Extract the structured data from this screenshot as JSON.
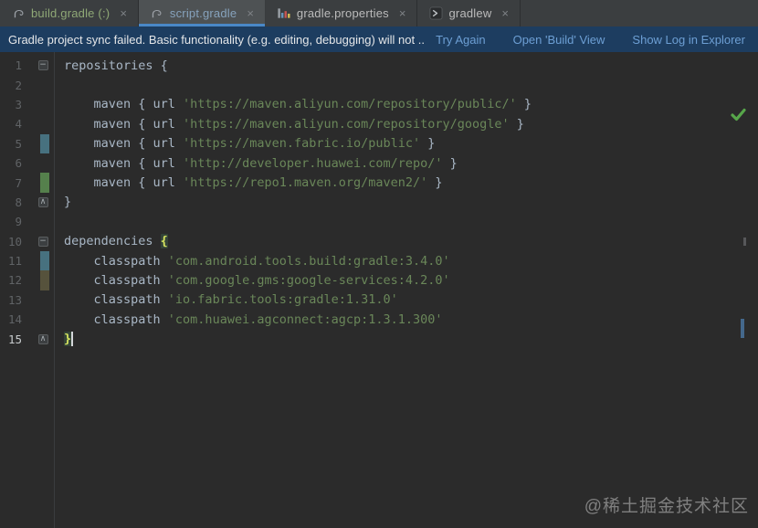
{
  "tabs": [
    {
      "label": "build.gradle (:)",
      "icon": "gradle-elephant",
      "label_color": "#8FA876",
      "active": false,
      "close": "×"
    },
    {
      "label": "script.gradle",
      "icon": "gradle-elephant",
      "label_color": "#86A2BC",
      "active": true,
      "close": "×"
    },
    {
      "label": "gradle.properties",
      "icon": "properties-file",
      "label_color": "#BBBBBB",
      "active": false,
      "close": "×"
    },
    {
      "label": "gradlew",
      "icon": "shell-script",
      "label_color": "#BBBBBB",
      "active": false,
      "close": "×"
    }
  ],
  "banner": {
    "message": "Gradle project sync failed. Basic functionality (e.g. editing, debugging) will not ...",
    "actions": [
      {
        "label": "Try Again"
      },
      {
        "label": "Open 'Build' View"
      },
      {
        "label": "Show Log in Explorer"
      }
    ]
  },
  "colors": {
    "active_tab_underline": "#4A88C7",
    "banner_bg": "#1D3D60",
    "link": "#6D9FD4",
    "code_plain": "#A9B7C6",
    "code_string": "#6A8759",
    "vcs_modified": "#47717F",
    "vcs_added": "#55804C",
    "vcs_modified_dim": "#56523C",
    "inspection_ok": "#57A64A"
  },
  "editor": {
    "lines": [
      {
        "num": "1",
        "fold": "open",
        "tokens": [
          {
            "t": "c",
            "s": "repositories {"
          }
        ]
      },
      {
        "num": "2",
        "tokens": []
      },
      {
        "num": "3",
        "tokens": [
          {
            "t": "c",
            "s": "    maven { url "
          },
          {
            "t": "s",
            "s": "'https://maven.aliyun.com/repository/public/'"
          },
          {
            "t": "c",
            "s": " }"
          }
        ]
      },
      {
        "num": "4",
        "tokens": [
          {
            "t": "c",
            "s": "    maven { url "
          },
          {
            "t": "s",
            "s": "'https://maven.aliyun.com/repository/google'"
          },
          {
            "t": "c",
            "s": " }"
          }
        ]
      },
      {
        "num": "5",
        "vcs": "modified",
        "tokens": [
          {
            "t": "c",
            "s": "    maven { url "
          },
          {
            "t": "s",
            "s": "'https://maven.fabric.io/public'"
          },
          {
            "t": "c",
            "s": " }"
          }
        ]
      },
      {
        "num": "6",
        "tokens": [
          {
            "t": "c",
            "s": "    maven { url "
          },
          {
            "t": "s",
            "s": "'http://developer.huawei.com/repo/'"
          },
          {
            "t": "c",
            "s": " }"
          }
        ]
      },
      {
        "num": "7",
        "vcs": "added",
        "tokens": [
          {
            "t": "c",
            "s": "    maven { url "
          },
          {
            "t": "s",
            "s": "'https://repo1.maven.org/maven2/'"
          },
          {
            "t": "c",
            "s": " }"
          }
        ]
      },
      {
        "num": "8",
        "fold": "close",
        "tokens": [
          {
            "t": "c",
            "s": "}"
          }
        ]
      },
      {
        "num": "9",
        "tokens": []
      },
      {
        "num": "10",
        "fold": "open",
        "tokens": [
          {
            "t": "c",
            "s": "dependencies "
          },
          {
            "t": "b",
            "s": "{"
          }
        ]
      },
      {
        "num": "11",
        "vcs": "modified",
        "tokens": [
          {
            "t": "c",
            "s": "    classpath "
          },
          {
            "t": "s",
            "s": "'com.android.tools.build:gradle:3.4.0'"
          }
        ]
      },
      {
        "num": "12",
        "vcs": "modified_dim",
        "tokens": [
          {
            "t": "c",
            "s": "    classpath "
          },
          {
            "t": "s",
            "s": "'com.google.gms:google-services:4.2.0'"
          }
        ]
      },
      {
        "num": "13",
        "tokens": [
          {
            "t": "c",
            "s": "    classpath "
          },
          {
            "t": "s",
            "s": "'io.fabric.tools:gradle:1.31.0'"
          }
        ]
      },
      {
        "num": "14",
        "tokens": [
          {
            "t": "c",
            "s": "    classpath "
          },
          {
            "t": "s",
            "s": "'com.huawei.agconnect:agcp:1.3.1.300'"
          }
        ]
      },
      {
        "num": "15",
        "current": true,
        "fold": "close",
        "caret": true,
        "tokens": [
          {
            "t": "b",
            "s": "}"
          }
        ]
      }
    ],
    "fold_glyphs": {
      "open": "−",
      "close": "∧"
    }
  },
  "watermark": "@稀土掘金技术社区"
}
